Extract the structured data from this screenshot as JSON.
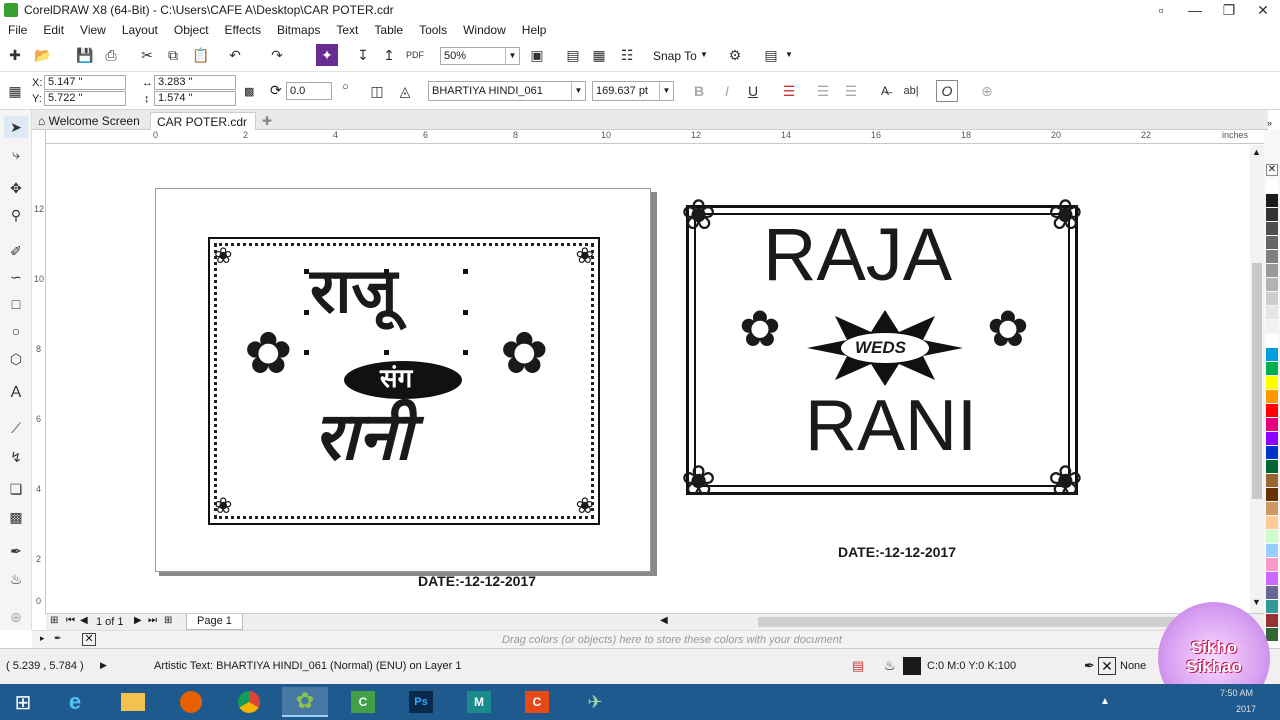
{
  "window": {
    "title": "CorelDRAW X8 (64-Bit) - C:\\Users\\CAFE A\\Desktop\\CAR POTER.cdr"
  },
  "menu": [
    "File",
    "Edit",
    "View",
    "Layout",
    "Object",
    "Effects",
    "Bitmaps",
    "Text",
    "Table",
    "Tools",
    "Window",
    "Help"
  ],
  "toolbar": {
    "zoom": "50%",
    "snap_label": "Snap To"
  },
  "props": {
    "x_label": "X:",
    "x": "5.147 \"",
    "y_label": "Y:",
    "y": "5.722 \"",
    "width": "3.283 \"",
    "height": "1.574 \"",
    "angle": "0.0",
    "font": "BHARTIYA HINDI_061",
    "font_size": "169.637 pt"
  },
  "tabs": {
    "welcome": "Welcome Screen",
    "document": "CAR POTER.cdr"
  },
  "ruler": {
    "top": [
      "0",
      "2",
      "4",
      "6",
      "8",
      "10",
      "12",
      "14",
      "16",
      "18",
      "20",
      "22"
    ],
    "unit": "inches",
    "left": [
      "12",
      "10",
      "8",
      "6",
      "4",
      "2",
      "0"
    ]
  },
  "canvas": {
    "left_card": {
      "line1": "राजू",
      "badge": "संग",
      "line2": "रानी",
      "date": "DATE:-12-12-2017"
    },
    "right_card": {
      "line1": "RAJA",
      "badge": "WEDS",
      "line2": "RANI",
      "date": "DATE:-12-12-2017"
    }
  },
  "pagebar": {
    "page_of": "1 of 1",
    "page_tab": "Page 1"
  },
  "docpalette": {
    "hint": "Drag colors (or objects) here to store these colors with your document"
  },
  "status": {
    "coords": "( 5.239 , 5.784 )",
    "info": "Artistic Text: BHARTIYA HINDI_061 (Normal) (ENU) on Layer 1",
    "fill": "C:0 M:0 Y:0 K:100",
    "outline": "None"
  },
  "watermark": {
    "text": "Sikho Sikhao"
  },
  "clock": {
    "time": "7:50 AM",
    "date": "2017"
  },
  "colors": {
    "taskbar": "#1f5a8f",
    "palette": [
      "#ffffff",
      "#1a1a1a",
      "#333333",
      "#4d4d4d",
      "#666666",
      "#808080",
      "#999999",
      "#b3b3b3",
      "#cccccc",
      "#e6e6e6",
      "#f2f2f2",
      "#ffffff",
      "#00a0e0",
      "#00b050",
      "#ffff00",
      "#ff9900",
      "#ff0000",
      "#e6007e",
      "#8b00ff",
      "#0033cc",
      "#006633",
      "#996633",
      "#663300",
      "#cc9966",
      "#ffcc99",
      "#ccffcc",
      "#99ccff",
      "#ff99cc",
      "#cc66ff",
      "#666699",
      "#339999",
      "#993333",
      "#336633"
    ]
  }
}
